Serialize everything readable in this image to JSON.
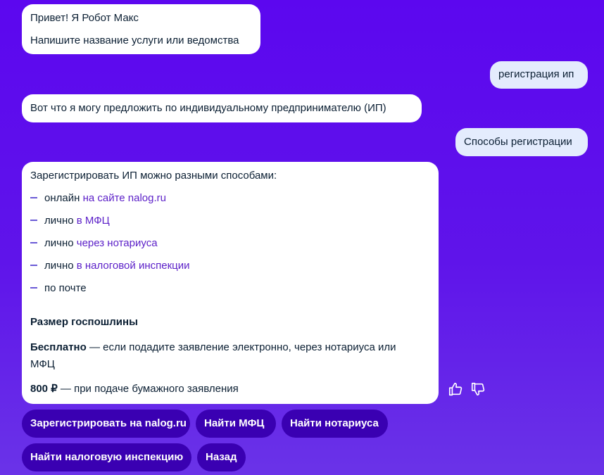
{
  "messages": {
    "bot_greeting_1": "Привет! Я Робот Макс",
    "bot_greeting_2": "Напишите название услуги или ведомства",
    "user_query_1": "регистрация ип",
    "bot_reply_1": "Вот что я могу предложить по индивидуальному предпринимателю (ИП)",
    "user_query_2": "Способы регистрации",
    "answer": {
      "intro": "Зарегистрировать ИП можно разными способами:",
      "items": [
        {
          "prefix": "онлайн ",
          "link": "на сайте nalog.ru"
        },
        {
          "prefix": "лично ",
          "link": "в МФЦ"
        },
        {
          "prefix": "лично ",
          "link": "через нотариуса"
        },
        {
          "prefix": "лично ",
          "link": "в налоговой инспекции"
        },
        {
          "prefix": "по почте",
          "link": ""
        }
      ],
      "fee_heading": "Размер госпошлины",
      "free_bold": "Бесплатно",
      "free_text_1": " — если подадите заявление электронно, через нотариуса или",
      "free_text_2": "МФЦ",
      "paid_bold": "800 ₽",
      "paid_text": " — при подаче бумажного заявления"
    }
  },
  "feedback": {
    "like_icon": "thumbs-up-icon",
    "dislike_icon": "thumbs-down-icon"
  },
  "quick_replies": [
    "Зарегистрировать на nalog.ru",
    "Найти МФЦ",
    "Найти нотариуса",
    "Найти налоговую инспекцию",
    "Назад"
  ],
  "colors": {
    "background": "#5c07ef",
    "bot_bubble": "#ffffff",
    "user_bubble": "#e4ecfd",
    "chip": "#3a00b2",
    "link": "#5b1fc8"
  }
}
